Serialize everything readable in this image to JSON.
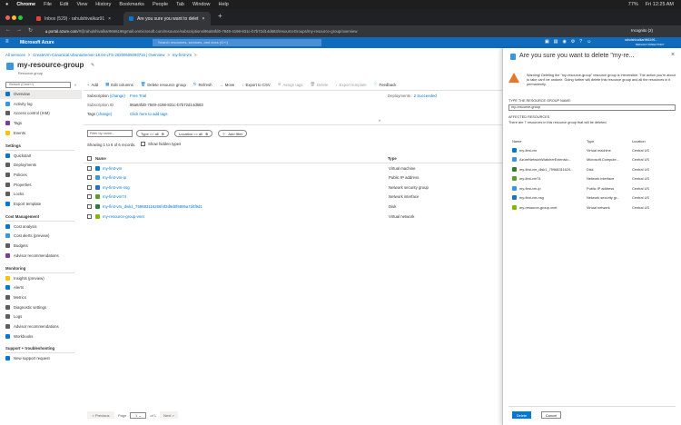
{
  "menubar": {
    "app": "Chrome",
    "items": [
      "File",
      "Edit",
      "View",
      "History",
      "Bookmarks",
      "People",
      "Tab",
      "Window",
      "Help"
    ],
    "battery": "77%",
    "clock": "Fri 12:25 AM"
  },
  "tabs": [
    {
      "label": "Inbox (529) - rahulshivalkar91"
    },
    {
      "label": "Are you sure you want to delet"
    }
  ],
  "address": {
    "host": "portal.azure.com",
    "path": "/#@rahulshivalkar9666196gmail.onmicrosoft.com/resource/subscriptions/96a84fd0-7849-4198-831c-b7b72d14d683/resourceGroups/my-resource-group/overview",
    "profile": "Incognito (2)"
  },
  "azure": {
    "brand": "Microsoft Azure",
    "search_placeholder": "Search resources, services, and docs (G+/)",
    "user": "rahulshivalkar966196...",
    "directory": "DEFAULT DIRECTORY"
  },
  "breadcrumb": [
    "All services",
    "CreateVm-Canonical.UbuntuServer-18.04-LTS-20200605093716 | Overview",
    "my-first-vm"
  ],
  "page": {
    "title": "my-resource-group",
    "subtitle": "Resource group"
  },
  "sidebar": {
    "search_placeholder": "Search (Cmd+/)",
    "sections": [
      {
        "heading": "",
        "items": [
          "Overview",
          "Activity log",
          "Access control (IAM)",
          "Tags",
          "Events"
        ]
      },
      {
        "heading": "Settings",
        "items": [
          "Quickstart",
          "Deployments",
          "Policies",
          "Properties",
          "Locks",
          "Export template"
        ]
      },
      {
        "heading": "Cost Management",
        "items": [
          "Cost analysis",
          "Cost alerts (preview)",
          "Budgets",
          "Advisor recommendations"
        ]
      },
      {
        "heading": "Monitoring",
        "items": [
          "Insights (preview)",
          "Alerts",
          "Metrics",
          "Diagnostic settings",
          "Logs",
          "Advisor recommendations",
          "Workbooks"
        ]
      },
      {
        "heading": "Support + troubleshooting",
        "items": [
          "New support request"
        ]
      }
    ]
  },
  "toolbar": [
    "Add",
    "Edit columns",
    "Delete resource group",
    "Refresh",
    "Move",
    "Export to CSV",
    "Assign tags",
    "Delete",
    "Export template",
    "Feedback"
  ],
  "essentials": {
    "subscription_label": "Subscription",
    "change": "(change)",
    "subscription": "Free Trial",
    "sub_id_label": "Subscription ID",
    "sub_id": "96a84fd0-7849-4198-831c-b7b72d14d683",
    "tags_label": "Tags",
    "tags_value": "Click here to add tags",
    "deployments_label": "Deployments",
    "deployments": "2 Succeeded"
  },
  "filters": {
    "name_placeholder": "Filter by name...",
    "type": "Type == all",
    "location": "Location == all",
    "add": "Add filter",
    "showing": "Showing 1 to 6 of 6 records.",
    "hidden": "Show hidden types"
  },
  "table": {
    "headers": [
      "Name",
      "Type"
    ],
    "rows": [
      {
        "name": "my-first-vm",
        "type": "Virtual machine",
        "color": "#0078d4"
      },
      {
        "name": "my-first-vm-ip",
        "type": "Public IP address",
        "color": "#3a96dd"
      },
      {
        "name": "my-first-vm-nsg",
        "type": "Network security group",
        "color": "#1e6fc8"
      },
      {
        "name": "my-first-vm74",
        "type": "Network interface",
        "color": "#5c9c2e"
      },
      {
        "name": "my-first-vm_disk1_759683116266f4f3d9d0f5895a7d4f9d1",
        "type": "Disk",
        "color": "#2f7d32"
      },
      {
        "name": "my-resource-group-vnet",
        "type": "Virtual network",
        "color": "#7fba00"
      }
    ]
  },
  "pagination": {
    "prev": "< Previous",
    "page": "Page",
    "value": "1",
    "of": "of 1",
    "next": "Next >"
  },
  "panel": {
    "title": "Are you sure you want to delete \"my-re...",
    "warning": "Warning! Deleting the \"my-resource-group\" resource group is irreversible. The action you're about to take can't be undone. Going further will delete this resource group and all the resources in it permanently.",
    "type_label": "TYPE THE RESOURCE GROUP NAME:",
    "input_value": "my-resource-group",
    "affected": "AFFECTED RESOURCES",
    "count_text": "There are 7 resources in this resource group that will be deleted.",
    "headers": [
      "Name",
      "Type",
      "Location"
    ],
    "rows": [
      {
        "name": "my-first-vm",
        "type": "Virtual machine",
        "loc": "Central US",
        "color": "#0078d4"
      },
      {
        "name": "AzureNetworkWatcherExtensio...",
        "type": "Microsoft.Compute...",
        "loc": "Central US",
        "color": "#3a96dd"
      },
      {
        "name": "my-first-vm_disk1_75968311620...",
        "type": "Disk",
        "loc": "Central US",
        "color": "#2f7d32"
      },
      {
        "name": "my-first-vm74",
        "type": "Network interface",
        "loc": "Central US",
        "color": "#5c9c2e"
      },
      {
        "name": "my-first-vm-ip",
        "type": "Public IP address",
        "loc": "Central US",
        "color": "#3a96dd"
      },
      {
        "name": "my-first-vm-nsg",
        "type": "Network security gr...",
        "loc": "Central US",
        "color": "#1e6fc8"
      },
      {
        "name": "my-resource-group-vnet",
        "type": "Virtual network",
        "loc": "Central US",
        "color": "#7fba00"
      }
    ],
    "delete": "Delete",
    "cancel": "Cancel"
  }
}
